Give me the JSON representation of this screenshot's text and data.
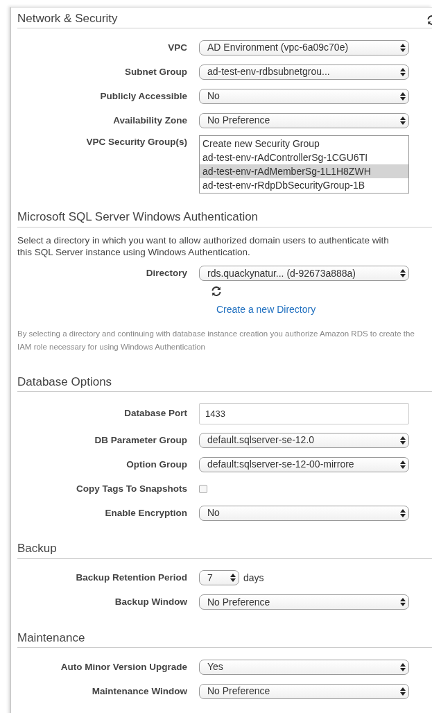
{
  "sections": [
    {
      "title": "Network & Security",
      "refresh_button": true,
      "items": [
        {
          "kind": "select",
          "label": "VPC",
          "value": "AD Environment (vpc-6a09c70e)"
        },
        {
          "kind": "select",
          "label": "Subnet Group",
          "value": "ad-test-env-rdbsubnetgrou..."
        },
        {
          "kind": "select",
          "label": "Publicly Accessible",
          "value": "No"
        },
        {
          "kind": "select",
          "label": "Availability Zone",
          "value": "No Preference"
        },
        {
          "kind": "listbox",
          "label": "VPC Security Group(s)",
          "options": [
            {
              "text": "Create new Security Group",
              "selected": false
            },
            {
              "text": "ad-test-env-rAdControllerSg-1CGU6TI",
              "selected": false
            },
            {
              "text": "ad-test-env-rAdMemberSg-1L1H8ZWH",
              "selected": true
            },
            {
              "text": "ad-test-env-rRdpDbSecurityGroup-1B",
              "selected": false
            }
          ]
        }
      ]
    },
    {
      "title": "Microsoft SQL Server Windows Authentication",
      "refresh_button": false,
      "items": [
        {
          "kind": "text",
          "text": "Select a directory in which you want to allow authorized domain users to authenticate with this SQL Server instance using Windows Authentication."
        },
        {
          "kind": "select",
          "label": "Directory",
          "value": "rds.quackynatur... (d-92673a888a)"
        },
        {
          "kind": "refresh"
        },
        {
          "kind": "link",
          "text": "Create a new Directory"
        },
        {
          "kind": "note",
          "text": "By selecting a directory and continuing with database instance creation you authorize Amazon RDS to create the IAM role necessary for using Windows Authentication"
        }
      ]
    },
    {
      "title": "Database Options",
      "refresh_button": false,
      "items": [
        {
          "kind": "input",
          "label": "Database Port",
          "value": "1433"
        },
        {
          "kind": "select",
          "label": "DB Parameter Group",
          "value": "default.sqlserver-se-12.0"
        },
        {
          "kind": "select",
          "label": "Option Group",
          "value": "default:sqlserver-se-12-00-mirrore"
        },
        {
          "kind": "checkbox",
          "label": "Copy Tags To Snapshots",
          "checked": false
        },
        {
          "kind": "select",
          "label": "Enable Encryption",
          "value": "No"
        }
      ]
    },
    {
      "title": "Backup",
      "refresh_button": false,
      "items": [
        {
          "kind": "number_select",
          "label": "Backup Retention Period",
          "value": "7",
          "suffix": "days"
        },
        {
          "kind": "select",
          "label": "Backup Window",
          "value": "No Preference"
        }
      ]
    },
    {
      "title": "Maintenance",
      "refresh_button": false,
      "items": [
        {
          "kind": "select",
          "label": "Auto Minor Version Upgrade",
          "value": "Yes"
        },
        {
          "kind": "select",
          "label": "Maintenance Window",
          "value": "No Preference"
        }
      ]
    }
  ]
}
